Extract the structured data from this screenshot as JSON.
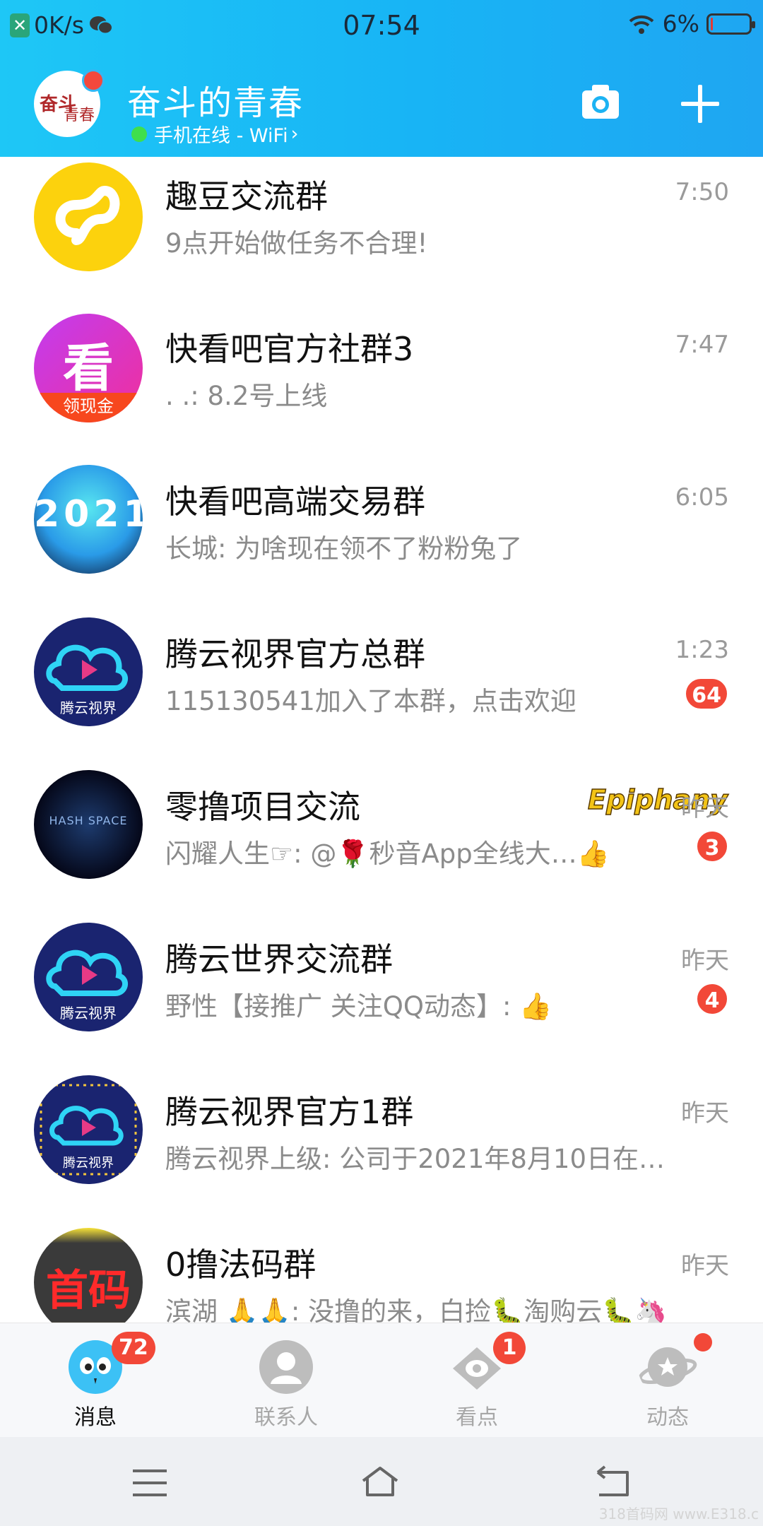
{
  "status_bar": {
    "net_speed": "0K/s",
    "time": "07:54",
    "battery": "6%",
    "battery_level": 0.06
  },
  "header": {
    "avatar_text": "奋斗的青春",
    "title": "奋斗的青春",
    "online_status": "手机在线 - WiFi",
    "camera_icon": "camera-icon",
    "plus_icon": "plus-icon"
  },
  "chats": [
    {
      "name": "趣豆交流群",
      "message": "9点开始做任务不合理!",
      "time": "7:50",
      "badge": ""
    },
    {
      "name": "快看吧官方社群3",
      "message": ".        .: 8.2号上线",
      "time": "7:47",
      "badge": "",
      "avatar_text": "看",
      "avatar_sub": "领现金"
    },
    {
      "name": "快看吧高端交易群",
      "message": "长城: 为啥现在领不了粉粉兔了",
      "time": "6:05",
      "badge": "",
      "avatar_text": "2021"
    },
    {
      "name": "腾云视界官方总群",
      "message": "115130541加入了本群，点击欢迎",
      "time": "1:23",
      "badge": "64",
      "avatar_text": "腾云视界"
    },
    {
      "name": "零撸项目交流",
      "message": "闪耀人生☞: @🌹秒音App全线大…👍",
      "time": "昨天",
      "badge": "3",
      "tag": "Epiphany",
      "avatar_text": "HASH SPACE"
    },
    {
      "name": "腾云世界交流群",
      "message": "野性【接推广 关注QQ动态】: 👍",
      "time": "昨天",
      "badge": "4",
      "avatar_text": "腾云视界"
    },
    {
      "name": "腾云视界官方1群",
      "message": "腾云视界上级: 公司于2021年8月10日在…",
      "time": "昨天",
      "badge": "",
      "avatar_text": "腾云视界"
    },
    {
      "name": "0撸法码群",
      "message": "滨湖 🙏🙏: 没撸的来，白捡🐛淘购云🐛🦄",
      "time": "昨天",
      "badge": "",
      "avatar_text": "首码"
    }
  ],
  "tabs": [
    {
      "label": "消息",
      "badge": "72",
      "icon": "message-icon",
      "active": true
    },
    {
      "label": "联系人",
      "badge": "",
      "icon": "contacts-icon",
      "active": false
    },
    {
      "label": "看点",
      "badge": "1",
      "icon": "eye-icon",
      "active": false
    },
    {
      "label": "动态",
      "badge": "",
      "dot": true,
      "icon": "planet-icon",
      "active": false
    }
  ],
  "watermark": "318首码网 www.E318.c",
  "colors": {
    "header": "#18b4f5",
    "badge": "#f24838",
    "online_dot": "#3fdf4c"
  }
}
